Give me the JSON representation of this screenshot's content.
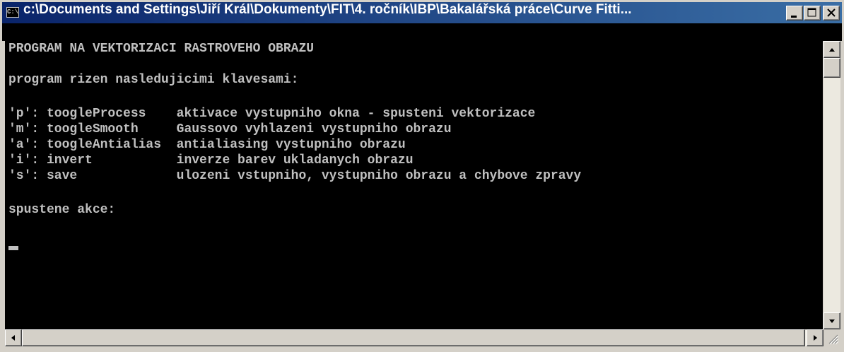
{
  "window": {
    "title": "c:\\Documents and Settings\\Jiří Král\\Dokumenty\\FIT\\4. ročník\\IBP\\Bakalářská práce\\Curve Fitti...",
    "icon_text": "C:\\"
  },
  "console": {
    "lines": [
      "PROGRAM NA VEKTORIZACI RASTROVEHO OBRAZU",
      "",
      "program rizen nasledujicimi klavesami:",
      "",
      "'p': toogleProcess    aktivace vystupniho okna - spusteni vektorizace",
      "'m': toogleSmooth     Gaussovo vyhlazeni vystupniho obrazu",
      "'a': toogleAntialias  antialiasing vystupniho obrazu",
      "'i': invert           inverze barev ukladanych obrazu",
      "'s': save             ulozeni vstupniho, vystupniho obrazu a chybove zpravy",
      "",
      "spustene akce:"
    ]
  },
  "icons": {
    "minimize": "minimize-icon",
    "maximize": "maximize-icon",
    "close": "close-icon",
    "scroll_up": "arrow-up-icon",
    "scroll_down": "arrow-down-icon",
    "scroll_left": "arrow-left-icon",
    "scroll_right": "arrow-right-icon",
    "resize_grip": "resize-grip-icon"
  },
  "colors": {
    "titlebar_start": "#0a246a",
    "titlebar_end": "#3a6ea5",
    "console_bg": "#000000",
    "console_text": "#c0c0c0"
  }
}
